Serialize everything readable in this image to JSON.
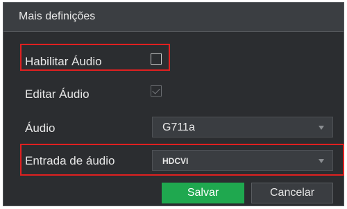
{
  "dialog": {
    "title": "Mais definições"
  },
  "rows": {
    "enable_audio": {
      "label": "Habilitar Áudio",
      "checked": false
    },
    "edit_audio": {
      "label": "Editar Áudio",
      "checked": true
    },
    "audio": {
      "label": "Áudio",
      "value": "G711a"
    },
    "audio_input": {
      "label": "Entrada de áudio",
      "value": "HDCVI"
    }
  },
  "buttons": {
    "save": "Salvar",
    "cancel": "Cancelar"
  },
  "colors": {
    "dialog_bg": "#2b2d30",
    "title_bg": "#3b3e42",
    "save_green": "#1fa84f",
    "highlight_red": "#e02020"
  }
}
